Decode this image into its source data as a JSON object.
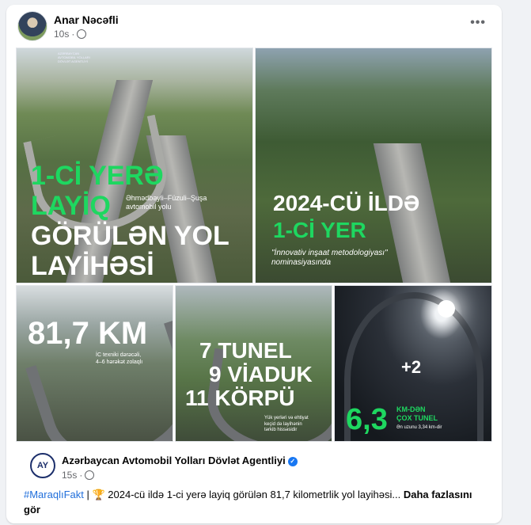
{
  "post": {
    "author": "Anar Nəcəfli",
    "time": "10s",
    "dot": "·",
    "more_icon": "•••"
  },
  "images": {
    "tile1": {
      "logo_text": "AZƏRBAYCAN AVTOMOBİL YOLLARI DÖVLƏT AGENTLİYİ",
      "line1": "1-Cİ YERƏ",
      "line2": "LAYİQ",
      "subtitle": "Əhmədbəyli–Füzuli–Şuşa\navtomobil yolu",
      "line3": "GÖRÜLƏN YOL",
      "line4": "LAYİHƏSİ"
    },
    "tile2": {
      "line1": "2024-CÜ İLDƏ",
      "line2": "1-Cİ YER",
      "subtitle": "\"İnnovativ inşaat metodologiyası\"\nnominasiyasında"
    },
    "tile3": {
      "headline": "81,7 KM",
      "subtitle": "İC texniki dərəcəli,\n4–6 hərəkət zolaqlı"
    },
    "tile4": {
      "line1": "7 TUNEL",
      "line2": "9 VİADUK",
      "line3": "11 KÖRPÜ",
      "subtitle": "Yük yerləri və ehtiyat\nkeçid də layihənin\ntərkib hissəsidir"
    },
    "tile5": {
      "plus": "+2",
      "big": "6,3",
      "line1": "KM-DƏN",
      "line2": "ÇOX TUNEL",
      "subtitle": "Ən uzunu 3,34 km-dir"
    }
  },
  "shared_post": {
    "logo_text": "AY",
    "org_name": "Azərbaycan Avtomobil Yolları Dövlət Agentliyi",
    "verified_icon": "✓",
    "time": "15s",
    "dot": "·",
    "hashtag": "#MaraqlıFakt",
    "text": " | 🏆 2024-cü ildə 1-ci yerə layiq görülən 81,7 kilometrlik yol layihəsi...",
    "see_more": " Daha fazlasını gör"
  },
  "colors": {
    "accent_green": "#1ed760",
    "link_blue": "#216fdb",
    "verified_blue": "#1877f2"
  }
}
